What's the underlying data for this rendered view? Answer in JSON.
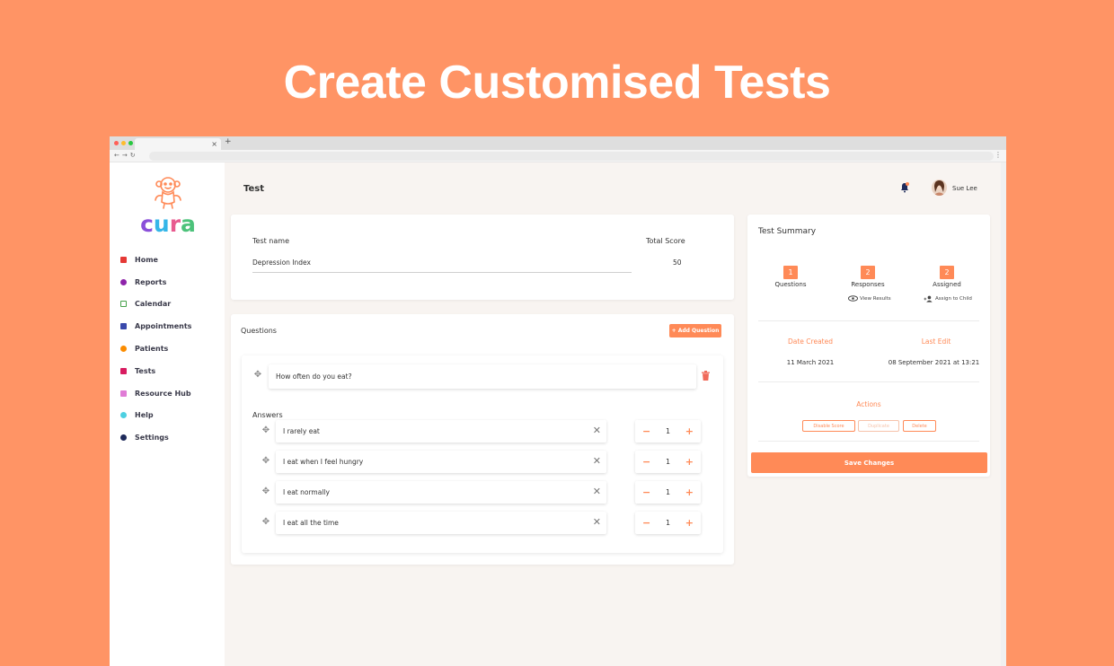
{
  "hero": {
    "title": "Create Customised Tests"
  },
  "colors": {
    "background": "#FF9465",
    "accent": "#FF8A57"
  },
  "sidebar": {
    "logo_text": "cura",
    "items": [
      {
        "label": "Home",
        "icon": "home-icon",
        "color": "#e53935"
      },
      {
        "label": "Reports",
        "icon": "reports-icon",
        "color": "#8e24aa"
      },
      {
        "label": "Calendar",
        "icon": "calendar-icon",
        "color": "#43a047"
      },
      {
        "label": "Appointments",
        "icon": "appointments-icon",
        "color": "#3949ab"
      },
      {
        "label": "Patients",
        "icon": "patients-icon",
        "color": "#fb8c00"
      },
      {
        "label": "Tests",
        "icon": "tests-icon",
        "color": "#d81b60"
      },
      {
        "label": "Resource Hub",
        "icon": "resource-hub-icon",
        "color": "#e07cd6"
      },
      {
        "label": "Help",
        "icon": "help-icon",
        "color": "#4dd0e1"
      },
      {
        "label": "Settings",
        "icon": "settings-icon",
        "color": "#1e2a5a"
      }
    ]
  },
  "header": {
    "title": "Test",
    "user_name": "Sue Lee"
  },
  "test_info": {
    "name_label": "Test name",
    "name_value": "Depression Index",
    "score_label": "Total Score",
    "score_value": "50"
  },
  "questions": {
    "title": "Questions",
    "add_button": "+ Add Question",
    "question_text": "How often do you eat?",
    "answers_label": "Answers",
    "answers": [
      {
        "text": "I rarely eat",
        "score": "1"
      },
      {
        "text": "I eat when I feel hungry",
        "score": "1"
      },
      {
        "text": "I eat normally",
        "score": "1"
      },
      {
        "text": "I eat all the time",
        "score": "1"
      }
    ]
  },
  "summary": {
    "title": "Test Summary",
    "stats": [
      {
        "value": "1",
        "label": "Questions"
      },
      {
        "value": "2",
        "label": "Responses"
      },
      {
        "value": "2",
        "label": "Assigned"
      }
    ],
    "view_results": "View Results",
    "assign_to_child": "Assign to Child",
    "date_created_label": "Date Created",
    "date_created_value": "11 March 2021",
    "last_edit_label": "Last Edit",
    "last_edit_value": "08 September 2021 at 13:21",
    "actions_label": "Actions",
    "disable_score": "Disable Score",
    "duplicate": "Duplicate",
    "delete": "Delete",
    "save_button": "Save Changes"
  }
}
